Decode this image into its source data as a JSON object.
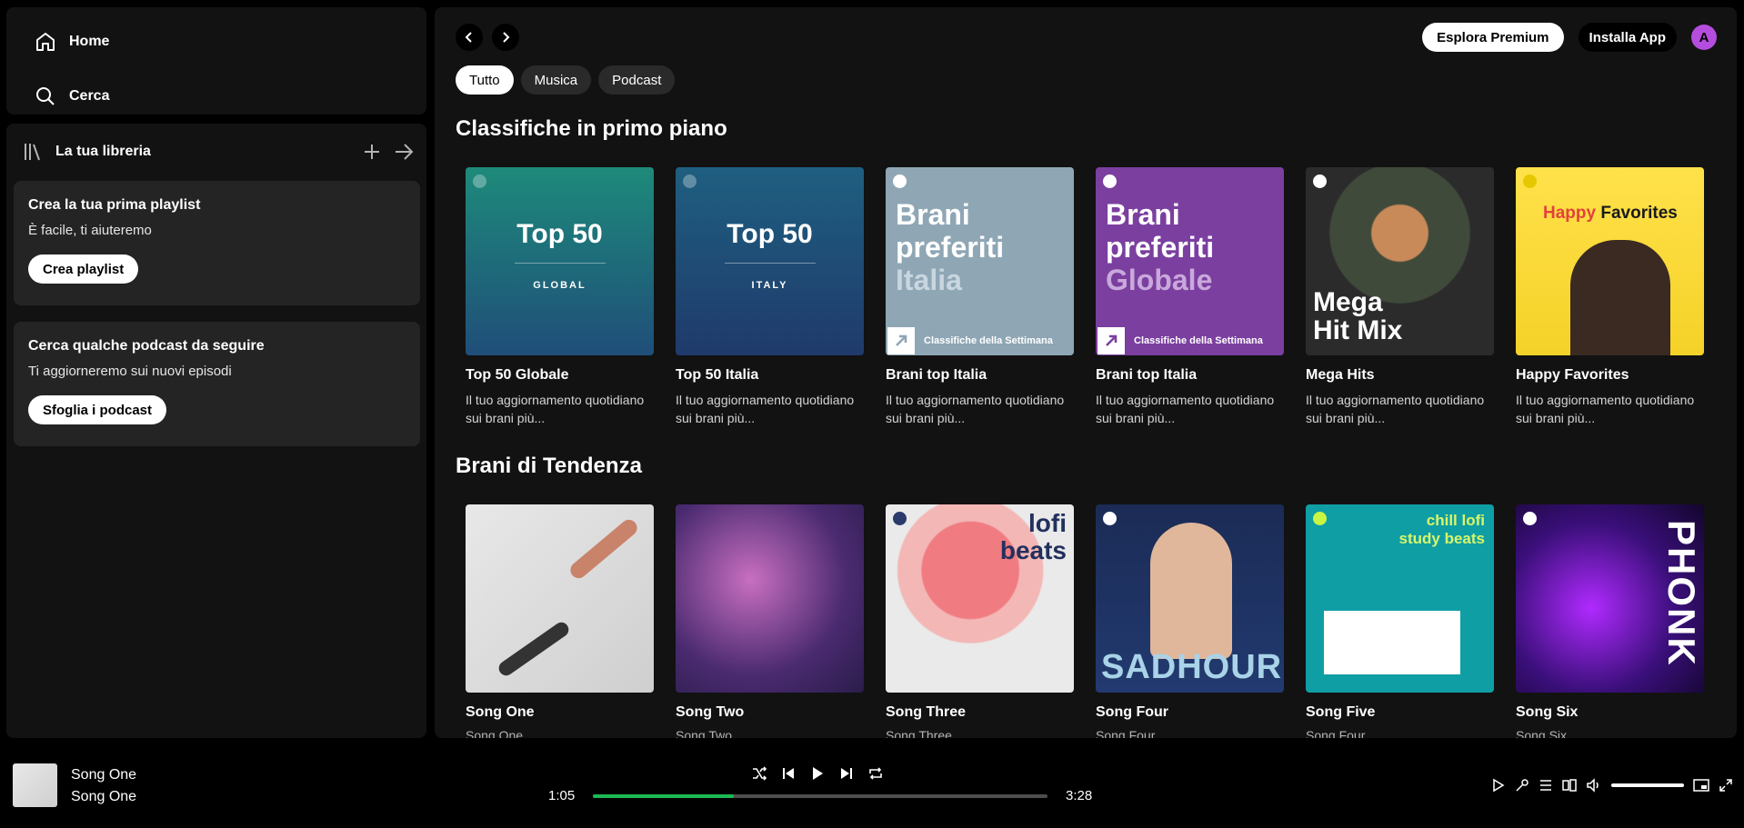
{
  "sidebar": {
    "nav": {
      "home": "Home",
      "search": "Cerca"
    },
    "library": {
      "title": "La tua libreria",
      "cards": [
        {
          "title": "Crea la tua prima playlist",
          "subtitle": "È facile, ti aiuteremo",
          "button": "Crea playlist"
        },
        {
          "title": "Cerca qualche podcast da seguire",
          "subtitle": "Ti aggiorneremo sui nuovi episodi",
          "button": "Sfoglia i podcast"
        }
      ]
    }
  },
  "header": {
    "premium_button": "Esplora Premium",
    "install_button": "Installa App",
    "avatar_initial": "A",
    "chips": [
      "Tutto",
      "Musica",
      "Podcast"
    ]
  },
  "sections": {
    "featured": {
      "title": "Classifiche in primo piano",
      "items": [
        {
          "title": "Top 50 Globale",
          "desc": "Il tuo aggiornamento quotidiano sui brani più...",
          "art_big": "Top 50",
          "art_small": "GLOBAL"
        },
        {
          "title": "Top 50 Italia",
          "desc": "Il tuo aggiornamento quotidiano sui brani più...",
          "art_big": "Top 50",
          "art_small": "ITALY"
        },
        {
          "title": "Brani top Italia",
          "desc": "Il tuo aggiornamento quotidiano sui brani più...",
          "art_l1": "Brani",
          "art_l2": "preferiti",
          "art_l3": "Italia",
          "art_footer": "Classifiche della Settimana"
        },
        {
          "title": "Brani top Italia",
          "desc": "Il tuo aggiornamento quotidiano sui brani più...",
          "art_l1": "Brani",
          "art_l2": "preferiti",
          "art_l3": "Globale",
          "art_footer": "Classifiche della Settimana"
        },
        {
          "title": "Mega Hits",
          "desc": "Il tuo aggiornamento quotidiano sui brani più...",
          "art_l1": "Mega",
          "art_l2": "Hit Mix"
        },
        {
          "title": "Happy Favorites",
          "desc": "Il tuo aggiornamento quotidiano sui brani più...",
          "art_l1": "Happy",
          "art_l2": "Favorites"
        }
      ]
    },
    "trending": {
      "title": "Brani di Tendenza",
      "items": [
        {
          "title": "Song One",
          "sub": "Song One"
        },
        {
          "title": "Song Two",
          "sub": "Song Two"
        },
        {
          "title": "Song Three",
          "sub": "Song Three",
          "art_l1": "lofi",
          "art_l2": "beats"
        },
        {
          "title": "Song Four",
          "sub": "Song Four",
          "art_l1": "SAD",
          "art_l2": "HOUR"
        },
        {
          "title": "Song Five",
          "sub": "Song Four",
          "art_l1": "chill lofi",
          "art_l2": "study beats"
        },
        {
          "title": "Song Six",
          "sub": "Song Six",
          "art_l1": "PHONK"
        }
      ]
    }
  },
  "player": {
    "title": "Song One",
    "artist": "Song One",
    "current_time": "1:05",
    "total_time": "3:28",
    "progress": 0.31,
    "volume": 1.0
  },
  "colors": {
    "accent": "#1db954",
    "avatar": "#b44dde"
  }
}
